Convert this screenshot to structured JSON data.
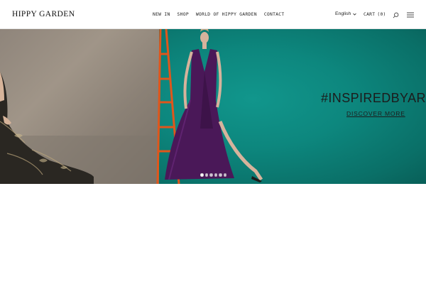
{
  "header": {
    "logo": "HIPPY GARDEN",
    "nav": [
      {
        "label": "NEW IN"
      },
      {
        "label": "SHOP"
      },
      {
        "label": "WORLD OF HIPPY GARDEN"
      },
      {
        "label": "CONTACT"
      }
    ],
    "language": "English",
    "cart_label": "CART",
    "cart_count": "(0)",
    "icons": {
      "language_dropdown": "chevron-down-icon",
      "search": "search-icon",
      "menu": "hamburger-menu-icon"
    }
  },
  "hero": {
    "heading": "#INSPIREDBYART",
    "cta": "DISCOVER MORE",
    "slide_count": 6,
    "active_slide": 1
  },
  "colors": {
    "teal_background": "#0d877e",
    "dress_purple": "#4a1858",
    "ladder_orange": "#e0561b",
    "text": "#1c1c1c"
  }
}
